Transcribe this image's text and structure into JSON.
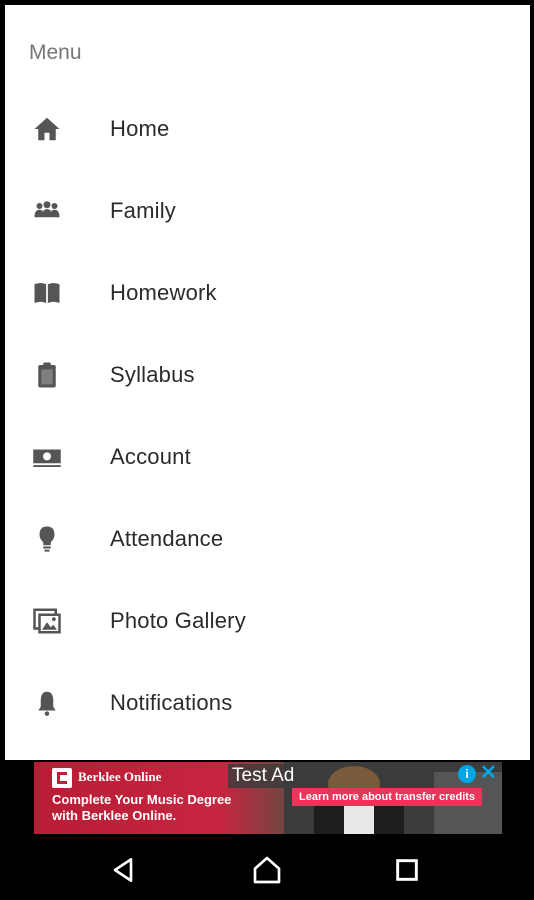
{
  "drawer": {
    "header": "Menu",
    "items": [
      {
        "label": "Home",
        "icon": "home-icon"
      },
      {
        "label": "Family",
        "icon": "people-icon"
      },
      {
        "label": "Homework",
        "icon": "book-icon"
      },
      {
        "label": "Syllabus",
        "icon": "clipboard-icon"
      },
      {
        "label": "Account",
        "icon": "money-icon"
      },
      {
        "label": "Attendance",
        "icon": "lightbulb-icon"
      },
      {
        "label": "Photo Gallery",
        "icon": "photo-gallery-icon"
      },
      {
        "label": "Notifications",
        "icon": "bell-icon"
      }
    ]
  },
  "ad": {
    "brand": "Berklee Online",
    "tag": "Test Ad",
    "info": "i",
    "close": "✕",
    "cta": "Learn more about transfer credits",
    "headline": "Complete Your Music Degree\nwith Berklee Online."
  },
  "system_nav": {
    "back": "back-icon",
    "home": "home-circle-icon",
    "recents": "recents-icon"
  },
  "colors": {
    "icon_gray": "#555555",
    "ad_red": "#c21f3a",
    "ad_cta": "#e8365a",
    "ad_info_blue": "#00a5e6"
  }
}
